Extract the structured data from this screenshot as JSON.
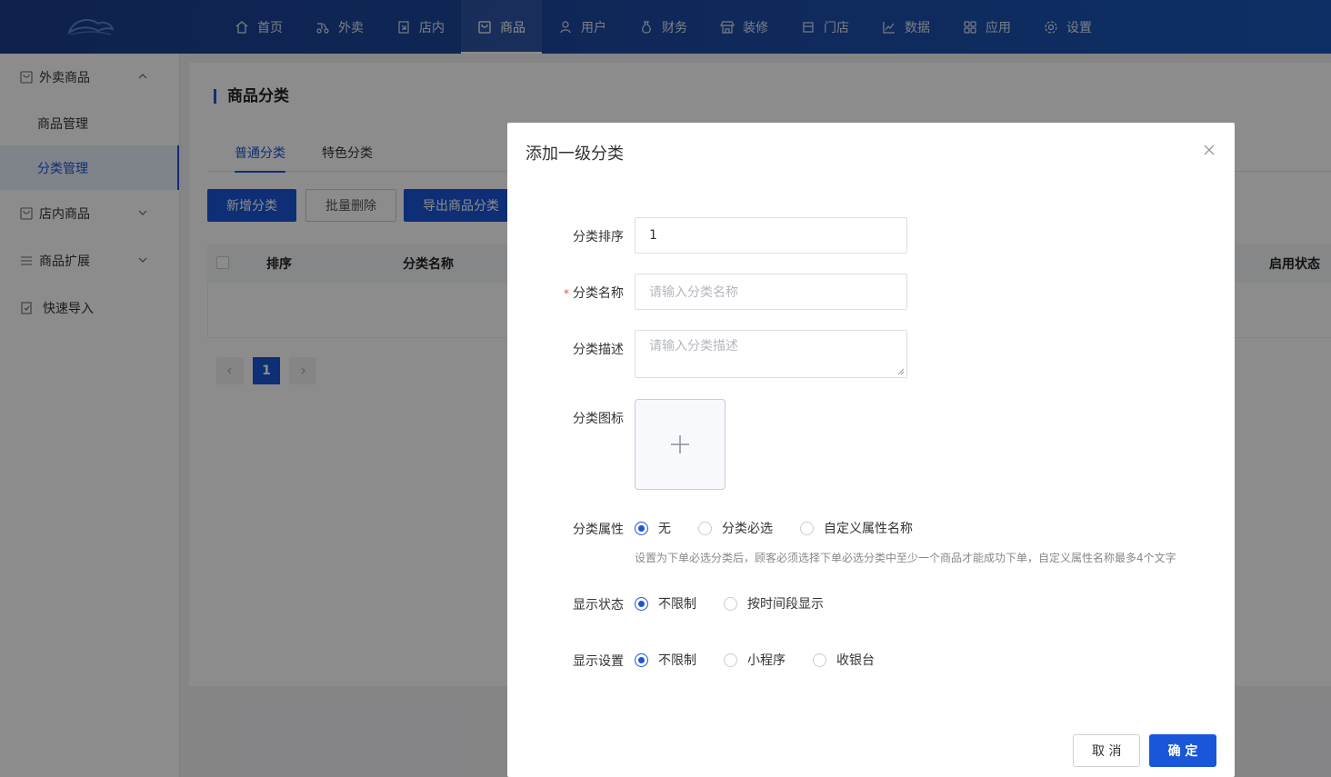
{
  "nav": {
    "items": [
      {
        "label": "首页",
        "icon": "home-icon"
      },
      {
        "label": "外卖",
        "icon": "scooter-icon"
      },
      {
        "label": "店内",
        "icon": "store-in-icon"
      },
      {
        "label": "商品",
        "icon": "goods-icon",
        "active": true
      },
      {
        "label": "用户",
        "icon": "user-icon"
      },
      {
        "label": "财务",
        "icon": "money-bag-icon"
      },
      {
        "label": "装修",
        "icon": "shop-decor-icon"
      },
      {
        "label": "门店",
        "icon": "store-icon"
      },
      {
        "label": "数据",
        "icon": "chart-icon"
      },
      {
        "label": "应用",
        "icon": "apps-icon"
      },
      {
        "label": "设置",
        "icon": "gear-icon"
      }
    ]
  },
  "sidebar": {
    "groups": [
      {
        "label": "外卖商品",
        "expanded": true,
        "items": [
          "商品管理",
          "分类管理"
        ]
      },
      {
        "label": "店内商品"
      },
      {
        "label": "商品扩展"
      },
      {
        "label": "快速导入"
      }
    ]
  },
  "page": {
    "title": "商品分类",
    "tabs": [
      "普通分类",
      "特色分类"
    ],
    "buttons": {
      "add": "新增分类",
      "batch_delete": "批量删除",
      "export": "导出商品分类"
    },
    "table": {
      "headers": [
        "排序",
        "分类名称",
        "启用状态"
      ]
    },
    "pagination": {
      "current": "1"
    }
  },
  "modal": {
    "title": "添加一级分类",
    "fields": {
      "sort": {
        "label": "分类排序",
        "value": "1"
      },
      "name": {
        "label": "分类名称",
        "required_mark": "*",
        "placeholder": "请输入分类名称"
      },
      "desc": {
        "label": "分类描述",
        "placeholder": "请输入分类描述"
      },
      "icon": {
        "label": "分类图标"
      },
      "attr": {
        "label": "分类属性",
        "options": [
          "无",
          "分类必选",
          "自定义属性名称"
        ],
        "selected": "无",
        "hint": "设置为下单必选分类后，顾客必须选择下单必选分类中至少一个商品才能成功下单，自定义属性名称最多4个文字"
      },
      "display_status": {
        "label": "显示状态",
        "options": [
          "不限制",
          "按时间段显示"
        ],
        "selected": "不限制"
      },
      "display_setting": {
        "label": "显示设置",
        "options": [
          "不限制",
          "小程序",
          "收银台"
        ],
        "selected": "不限制"
      }
    },
    "cancel": "取 消",
    "confirm": "确 定"
  },
  "colors": {
    "primary": "#1a56d8",
    "nav_bg": "#1d4aa3"
  }
}
